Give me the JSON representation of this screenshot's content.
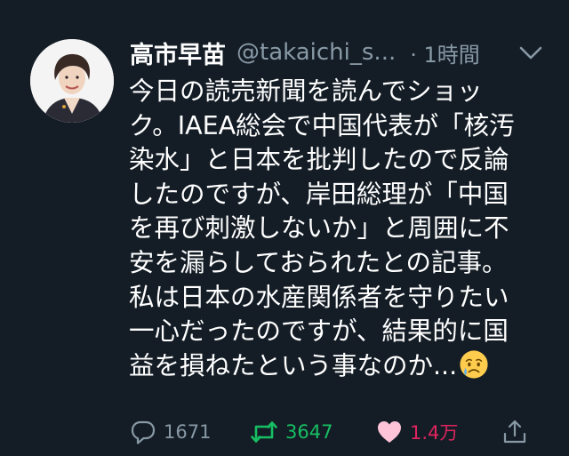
{
  "tweet": {
    "display_name": "高市早苗",
    "handle": "@takaichi_s...",
    "time": "· 1時間",
    "body_lines": [
      "今日の読売新聞を読んでショッ",
      "ク。IAEA総会で中国代表が「核汚",
      "染水」と日本を批判したので反論",
      "したのですが、岸田総理が「中国",
      "を再び刺激しないか」と周囲に不",
      "安を漏らしておられたとの記事。",
      "私は日本の水産関係者を守りたい",
      "一心だったのですが、結果的に国",
      "益を損ねたという事なのか..."
    ],
    "emoji": "crying-face-emoji"
  },
  "actions": {
    "reply_count": "1671",
    "retweet_count": "3647",
    "like_count": "1.4万"
  },
  "colors": {
    "background": "#141d26",
    "secondary_text": "#8899a6",
    "retweet_active": "#17bf63",
    "like_active": "#e0245e"
  }
}
